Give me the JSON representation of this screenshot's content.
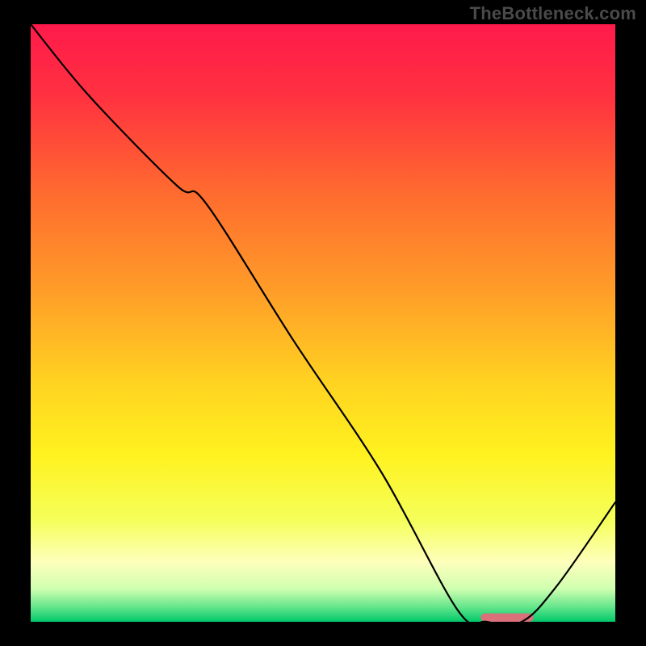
{
  "watermark": "TheBottleneck.com",
  "chart_data": {
    "type": "line",
    "title": "",
    "xlabel": "",
    "ylabel": "",
    "xlim": [
      0,
      100
    ],
    "ylim": [
      0,
      100
    ],
    "grid": false,
    "legend": false,
    "series": [
      {
        "name": "bottleneck-curve",
        "x": [
          0,
          10,
          25,
          30,
          45,
          60,
          73,
          78,
          84,
          90,
          100
        ],
        "y": [
          100,
          88,
          73,
          70,
          47,
          25,
          2,
          0,
          0,
          6,
          20
        ]
      }
    ],
    "marker": {
      "name": "optimal-range",
      "x_start": 77,
      "x_end": 86,
      "y": 0.7,
      "color": "#d9707a"
    },
    "background_gradient_stops": [
      {
        "offset": 0.0,
        "color": "#ff1a4b"
      },
      {
        "offset": 0.12,
        "color": "#ff3140"
      },
      {
        "offset": 0.28,
        "color": "#ff6a2f"
      },
      {
        "offset": 0.45,
        "color": "#ff9e28"
      },
      {
        "offset": 0.6,
        "color": "#ffd321"
      },
      {
        "offset": 0.72,
        "color": "#fff21f"
      },
      {
        "offset": 0.83,
        "color": "#f5ff5a"
      },
      {
        "offset": 0.9,
        "color": "#feffbb"
      },
      {
        "offset": 0.945,
        "color": "#cfffb0"
      },
      {
        "offset": 0.975,
        "color": "#66e68c"
      },
      {
        "offset": 1.0,
        "color": "#00c86a"
      }
    ]
  }
}
